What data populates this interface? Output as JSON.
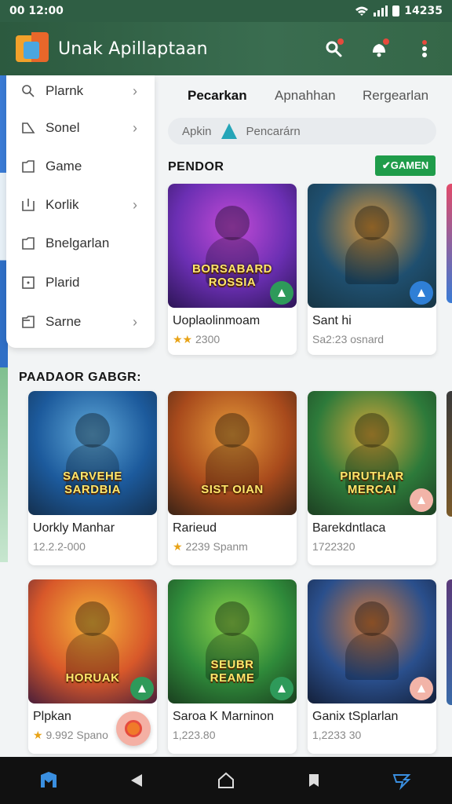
{
  "status": {
    "time": "00 12:00",
    "right": "14235"
  },
  "appbar": {
    "title": "Unak Apillaptaan"
  },
  "drawer": {
    "items": [
      {
        "label": "Plarnk",
        "chevron": true
      },
      {
        "label": "Sonel",
        "chevron": true
      },
      {
        "label": "Game",
        "chevron": false
      },
      {
        "label": "Korlik",
        "chevron": true
      },
      {
        "label": "Bnelgarlan",
        "chevron": false
      },
      {
        "label": "Plarid",
        "chevron": false
      },
      {
        "label": "Sarne",
        "chevron": true
      }
    ]
  },
  "tabs": [
    "Pecarkan",
    "Apnahhan",
    "Rergearlan"
  ],
  "search": {
    "text": "Apkin",
    "placeholder": "Pencarárn"
  },
  "section1": {
    "title": "PENDOR",
    "badge": "✔GAMEN"
  },
  "section2": {
    "title": "PAADAOR GABGR:"
  },
  "cards": [
    {
      "name": "Uoplaolinmoam",
      "meta": "2300",
      "stars": "★★",
      "overlay": "BORSABARD\nROSSIA",
      "colors": [
        "#6b2fb3",
        "#c24bd6",
        "#2d1556"
      ],
      "fab": "#2e9a5a"
    },
    {
      "name": "Sant hi",
      "meta": "Sa2:23 osnard",
      "stars": "",
      "overlay": "",
      "colors": [
        "#1f4f6f",
        "#d8953a",
        "#173544"
      ],
      "fab": "#2f7fd6"
    },
    {
      "name": "Uorkly Manhar",
      "meta": "12.2.2-000",
      "stars": "",
      "overlay": "SARVEHE\nSARDBIA",
      "colors": [
        "#1c5a9c",
        "#5fa8d8",
        "#14304f"
      ],
      "fab": ""
    },
    {
      "name": "Rarieud",
      "meta": "2239 Spanm",
      "stars": "★",
      "overlay": "SIST OIAN",
      "colors": [
        "#a84a1c",
        "#e59a3a",
        "#3a2316"
      ],
      "fab": ""
    },
    {
      "name": "Barekdntlaca",
      "meta": "1722320",
      "stars": "",
      "overlay": "PIRUTHAR\nMERCAI",
      "colors": [
        "#2d7a3a",
        "#d6a83a",
        "#1d3f22"
      ],
      "fab": "#f2b4a8"
    },
    {
      "name": "Plpkan",
      "meta": "9.992 Spano",
      "stars": "★",
      "overlay": "HORUAK",
      "colors": [
        "#d8582a",
        "#f4b43a",
        "#4a1f3a"
      ],
      "fab": "#2e9a5a"
    },
    {
      "name": "Saroa K Marninon",
      "meta": "1,223.80",
      "stars": "",
      "overlay": "SEUBR\nREAME",
      "colors": [
        "#2f8a3a",
        "#8cd24a",
        "#1a3f1f"
      ],
      "fab": "#2e9a5a"
    },
    {
      "name": "Ganix tSplarlan",
      "meta": "1,2233 30",
      "stars": "",
      "overlay": "",
      "colors": [
        "#2a4f8c",
        "#d27a3a",
        "#14203a"
      ],
      "fab": "#f2b4a8"
    }
  ]
}
